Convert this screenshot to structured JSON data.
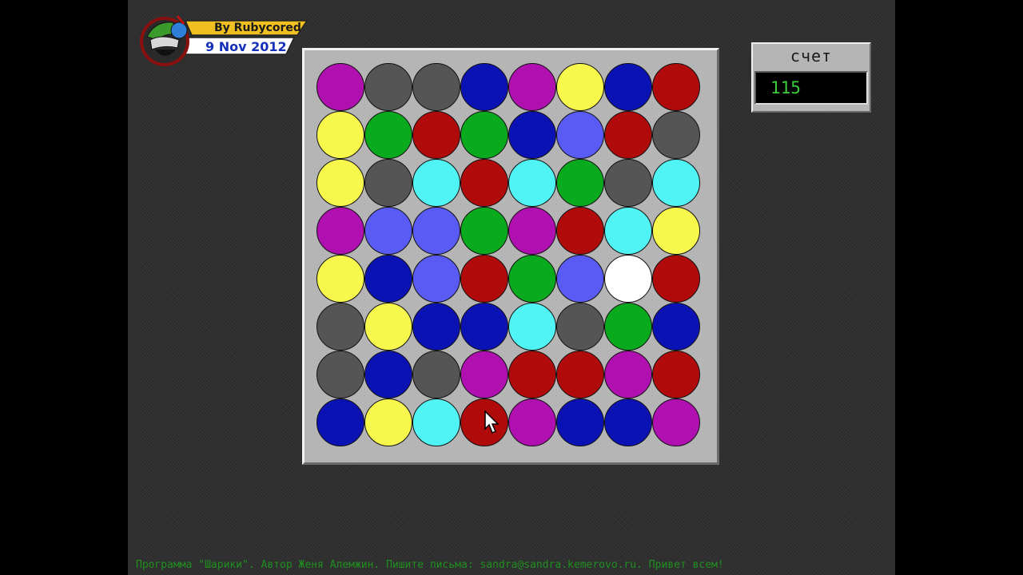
{
  "logo": {
    "author": "By Rubycored",
    "date": "9 Nov 2012"
  },
  "score": {
    "label": "счет",
    "value": "115"
  },
  "board": {
    "colors": {
      "magenta": "#b010b0",
      "gray": "#555555",
      "blue": "#0a12b4",
      "yellow": "#f8f84c",
      "red": "#b00a0a",
      "green": "#0aaa1e",
      "periwinkle": "#5a5af4",
      "cyan": "#50f4f4",
      "white": "#ffffff"
    },
    "rows": [
      [
        "magenta",
        "gray",
        "gray",
        "blue",
        "magenta",
        "yellow",
        "blue",
        "red"
      ],
      [
        "yellow",
        "green",
        "red",
        "green",
        "blue",
        "periwinkle",
        "red",
        "gray"
      ],
      [
        "yellow",
        "gray",
        "cyan",
        "red",
        "cyan",
        "green",
        "gray",
        "cyan"
      ],
      [
        "magenta",
        "periwinkle",
        "periwinkle",
        "green",
        "magenta",
        "red",
        "cyan",
        "yellow"
      ],
      [
        "yellow",
        "blue",
        "periwinkle",
        "red",
        "green",
        "periwinkle",
        "white",
        "red"
      ],
      [
        "gray",
        "yellow",
        "blue",
        "blue",
        "cyan",
        "gray",
        "green",
        "blue"
      ],
      [
        "gray",
        "blue",
        "gray",
        "magenta",
        "red",
        "red",
        "magenta",
        "red"
      ],
      [
        "blue",
        "yellow",
        "cyan",
        "red",
        "magenta",
        "blue",
        "blue",
        "magenta"
      ]
    ]
  },
  "footer": {
    "text": "Программа \"Шарики\". Автор Женя Алемжин. Пишите письма: sandra@sandra.kemerovo.ru. Привет всем!"
  }
}
